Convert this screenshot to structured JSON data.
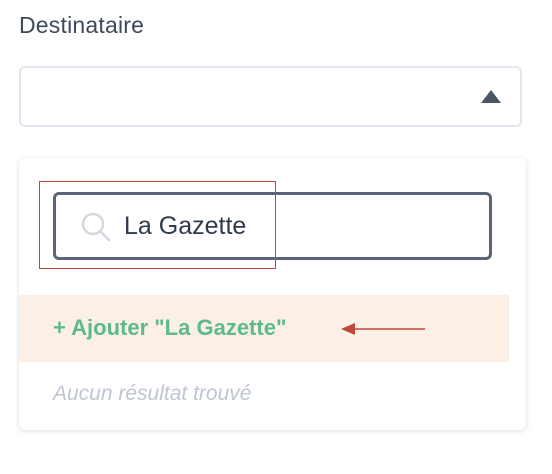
{
  "field": {
    "label": "Destinataire",
    "selected_value": ""
  },
  "dropdown": {
    "search": {
      "value": "La Gazette",
      "icon": "search-icon"
    },
    "add_option_label": "+ Ajouter \"La Gazette\"",
    "no_results_text": "Aucun résultat trouvé"
  },
  "colors": {
    "label_text": "#3d4a5c",
    "search_border": "#5a6677",
    "add_option_text": "#5dba8e",
    "add_option_bg": "#fcefe6",
    "annotation_red": "#c0473a",
    "placeholder_text": "#bfc5d2"
  }
}
